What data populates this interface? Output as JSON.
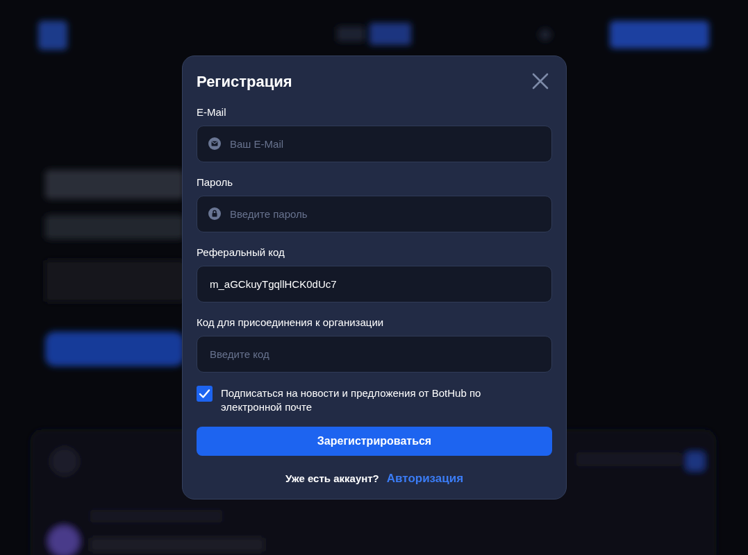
{
  "dialog": {
    "title": "Регистрация",
    "fields": [
      {
        "kind": "email",
        "label": "E-Mail",
        "placeholder": "Ваш E-Mail"
      },
      {
        "kind": "password",
        "label": "Пароль",
        "placeholder": "Введите пароль"
      },
      {
        "kind": "text",
        "label": "Реферальный код",
        "value": "m_aGCkuyTgqllHCK0dUc7"
      },
      {
        "kind": "text",
        "label": "Код для присоединения к организации",
        "placeholder": "Введите код"
      }
    ],
    "newsletter": {
      "label": "Подписаться на новости и предложения от BotHub по электронной почте",
      "checked": true
    },
    "submit_button": "Зарегистрироваться",
    "footer": {
      "text": "Уже есть аккаунт?",
      "link": "Авторизация"
    }
  }
}
